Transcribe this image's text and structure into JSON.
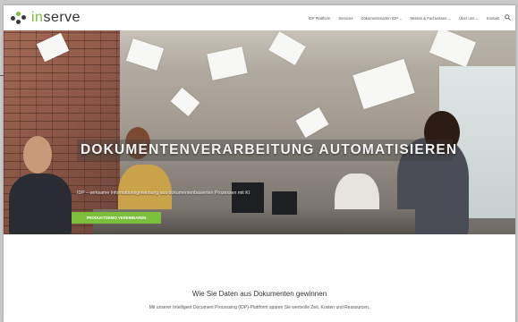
{
  "header": {
    "logo": {
      "text_main": "in",
      "text_rest": "serve"
    },
    "nav": [
      "IDP Plattform",
      "Services",
      "Dokumentenarten IDP ⌄",
      "Wissen & Fachwissen ⌄",
      "Über uns ⌄",
      "Kontakt"
    ],
    "search_icon": "search-icon"
  },
  "hero": {
    "title": "DOKUMENTENVERARBEITUNG AUTOMATISIEREN",
    "subtitle": "IDP – wirksame Informationsgewinnung aus dokumentenbasierten Prozessen mit KI",
    "button_label": "PRODUKTDEMO VEREINBAREN"
  },
  "section": {
    "title": "Wie Sie Daten aus Dokumenten gewinnen",
    "subtitle": "Mit unserer Intelligent Document Processing (IDP)-Plattform sparen Sie wertvolle Zeit, Kosten und Ressourcen."
  },
  "colors": {
    "accent": "#7cbf3b",
    "text": "#333333"
  }
}
